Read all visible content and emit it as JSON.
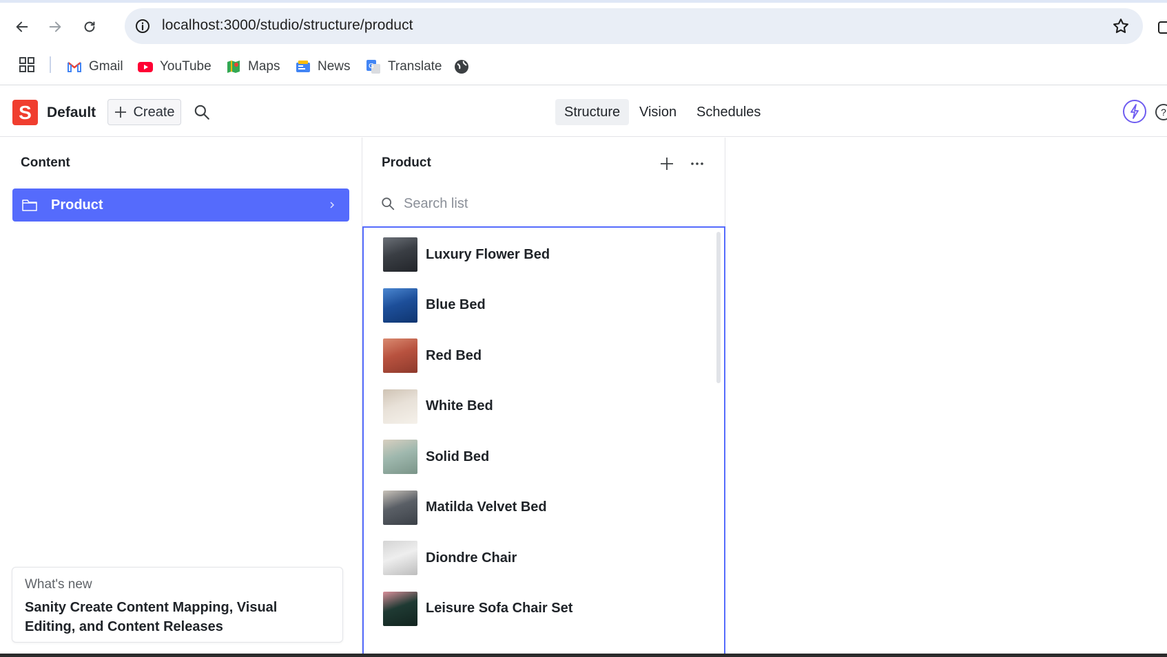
{
  "browser": {
    "url": "localhost:3000/studio/structure/product",
    "bookmarks": [
      {
        "label": "Gmail",
        "icon": "gmail-icon"
      },
      {
        "label": "YouTube",
        "icon": "youtube-icon"
      },
      {
        "label": "Maps",
        "icon": "maps-icon"
      },
      {
        "label": "News",
        "icon": "news-icon"
      },
      {
        "label": "Translate",
        "icon": "translate-icon"
      }
    ]
  },
  "studio": {
    "logo_letter": "S",
    "workspace": "Default",
    "create_label": "Create",
    "tabs": [
      {
        "label": "Structure",
        "active": true
      },
      {
        "label": "Vision",
        "active": false
      },
      {
        "label": "Schedules",
        "active": false
      }
    ],
    "accent": "#556bfc"
  },
  "content_pane": {
    "title": "Content",
    "items": [
      {
        "label": "Product",
        "selected": true
      }
    ]
  },
  "whats_new": {
    "kicker": "What's new",
    "title": "Sanity Create Content Mapping, Visual Editing, and Content Releases"
  },
  "product_pane": {
    "title": "Product",
    "search_placeholder": "Search list",
    "items": [
      {
        "label": "Luxury Flower Bed",
        "thumb": [
          "#3a3e44",
          "#6b7077",
          "#22252a"
        ]
      },
      {
        "label": "Blue Bed",
        "thumb": [
          "#1d4f9a",
          "#4a86d0",
          "#0f3570"
        ]
      },
      {
        "label": "Red Bed",
        "thumb": [
          "#b8523f",
          "#d98a70",
          "#8e3a2c"
        ]
      },
      {
        "label": "White Bed",
        "thumb": [
          "#e8e1d8",
          "#cfc3b4",
          "#f5f1ea"
        ]
      },
      {
        "label": "Solid Bed",
        "thumb": [
          "#9fb8ae",
          "#d8cfc0",
          "#7a9488"
        ]
      },
      {
        "label": "Matilda Velvet Bed",
        "thumb": [
          "#5a5f66",
          "#c9c3ba",
          "#3b4047"
        ]
      },
      {
        "label": "Diondre Chair",
        "thumb": [
          "#eeeeee",
          "#d4d4d4",
          "#bdbdbd"
        ]
      },
      {
        "label": "Leisure Sofa Chair Set",
        "thumb": [
          "#1f3a33",
          "#d98f9a",
          "#12241f"
        ]
      }
    ]
  }
}
